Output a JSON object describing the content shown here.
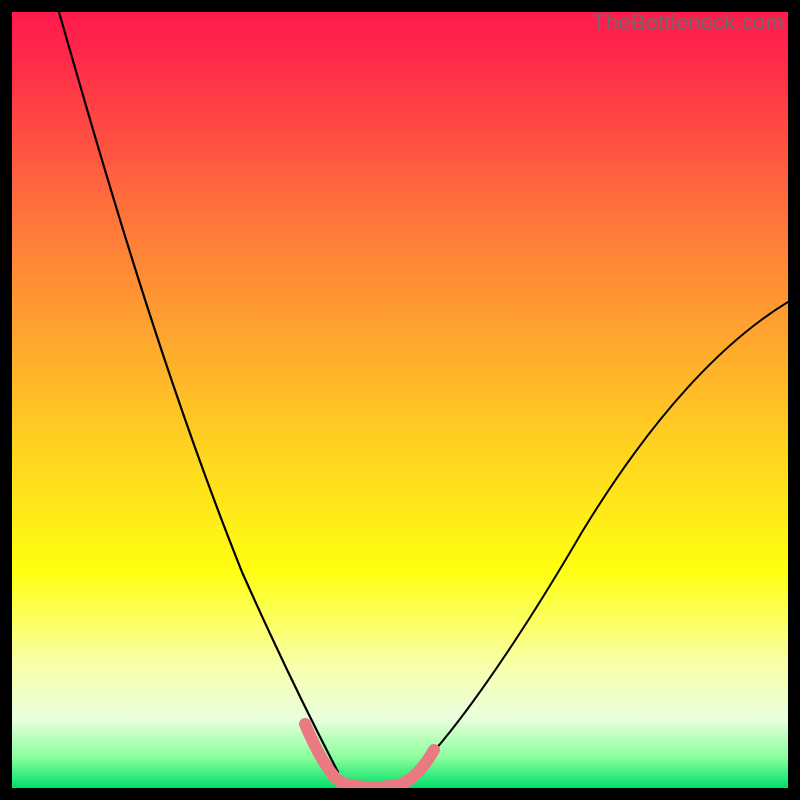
{
  "watermark": "TheBottleneck.com",
  "chart_data": {
    "type": "line",
    "title": "",
    "xlabel": "",
    "ylabel": "",
    "xlim": [
      0,
      100
    ],
    "ylim": [
      0,
      100
    ],
    "grid": false,
    "legend": false,
    "series": [
      {
        "name": "left-curve",
        "color": "#000000",
        "x": [
          6,
          10,
          14,
          18,
          22,
          26,
          30,
          34,
          38,
          40,
          42
        ],
        "y": [
          100,
          86,
          72,
          58,
          45,
          33,
          23,
          14,
          6,
          2,
          0
        ]
      },
      {
        "name": "right-curve",
        "color": "#000000",
        "x": [
          50,
          54,
          58,
          64,
          70,
          76,
          82,
          88,
          94,
          100
        ],
        "y": [
          0,
          2,
          6,
          12,
          20,
          29,
          38,
          47,
          55,
          62
        ]
      },
      {
        "name": "trough-highlight",
        "color": "#e97a82",
        "x": [
          38,
          40,
          42,
          44,
          46,
          48,
          50,
          52,
          54
        ],
        "y": [
          7,
          3,
          1,
          0,
          0,
          0,
          0,
          1,
          3
        ]
      }
    ],
    "background_gradient": {
      "orientation": "vertical",
      "stops": [
        {
          "pos": 0.0,
          "color": "#ff1a4d"
        },
        {
          "pos": 0.28,
          "color": "#ff7a3a"
        },
        {
          "pos": 0.58,
          "color": "#ffd81f"
        },
        {
          "pos": 0.84,
          "color": "#f8ffa8"
        },
        {
          "pos": 1.0,
          "color": "#00e06a"
        }
      ]
    }
  }
}
